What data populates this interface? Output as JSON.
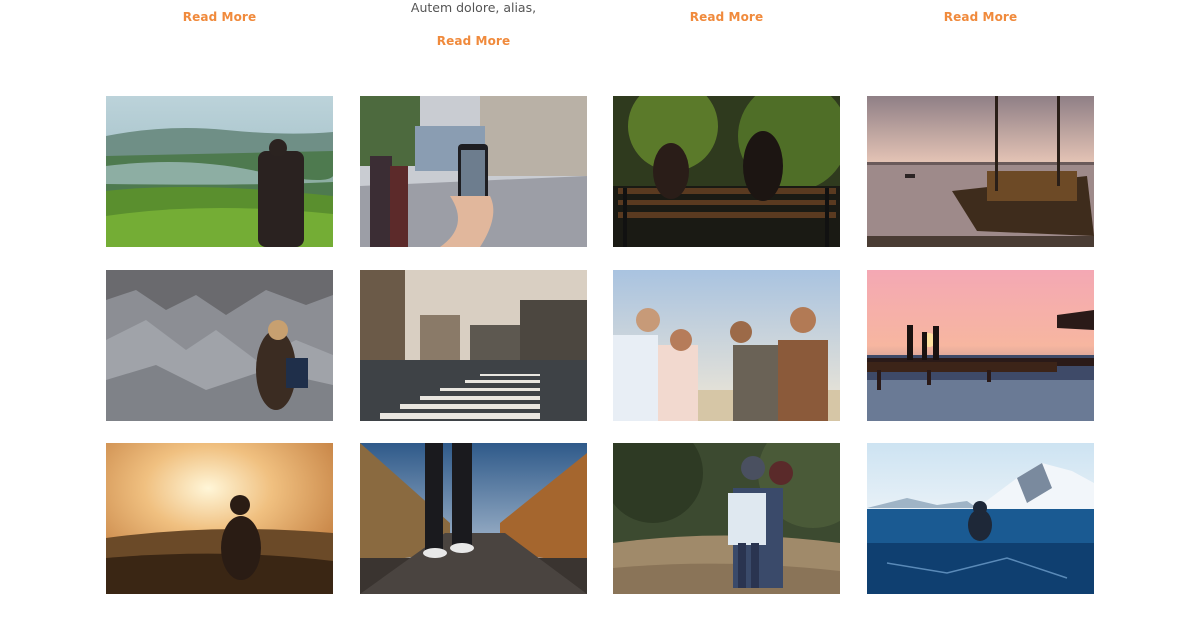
{
  "top_section": {
    "columns": [
      {
        "excerpt": "",
        "read_more": "Read More"
      },
      {
        "excerpt": "Autem dolore, alias,",
        "read_more": "Read More"
      },
      {
        "excerpt": "",
        "read_more": "Read More"
      },
      {
        "excerpt": "",
        "read_more": "Read More"
      }
    ]
  },
  "colors": {
    "accent": "#f08a3c",
    "text": "#555555",
    "background": "#ffffff"
  },
  "gallery": {
    "photos": [
      {
        "name": "tea-plantation-hiker-photo"
      },
      {
        "name": "city-street-phone-photo"
      },
      {
        "name": "couple-on-bench-photo"
      },
      {
        "name": "sailboat-at-dusk-photo"
      },
      {
        "name": "woman-on-rocky-mountains-photo"
      },
      {
        "name": "paris-crosswalk-photo"
      },
      {
        "name": "friends-laughing-outdoors-photo"
      },
      {
        "name": "family-on-pier-sunset-photo"
      },
      {
        "name": "woman-watching-sunset-photo"
      },
      {
        "name": "walking-on-bridge-photo"
      },
      {
        "name": "mother-and-child-photo"
      },
      {
        "name": "person-on-frozen-lake-photo"
      }
    ]
  }
}
